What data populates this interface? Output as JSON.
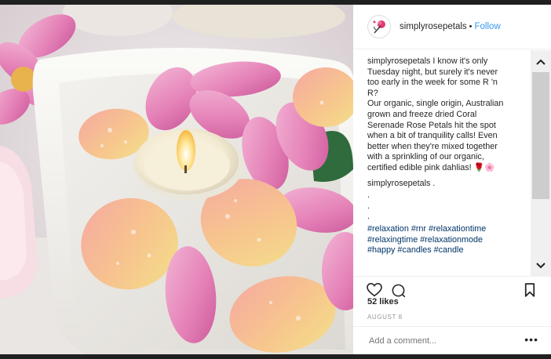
{
  "header": {
    "username": "simplyrosepetals",
    "separator": "•",
    "follow_label": "Follow"
  },
  "caption": {
    "author": "simplyrosepetals",
    "paragraph1": "I know it's only Tuesday night, but surely it's never too early in the week for some R 'n R?",
    "paragraph2": "Our organic, single origin, Australian grown and freeze dried Coral Serenade Rose Petals hit the spot when a bit of tranquility calls! Even better when they're mixed together with a sprinkling of our organic, certified edible pink dahlias! 🌹🌸",
    "author2": "simplyrosepetals",
    "trail": " .",
    "dots": [
      ".",
      ".",
      "."
    ],
    "hashtags": "#relaxation #rnr #relaxationtime #relaxingtime #relaxationmode #happy #candles #candle"
  },
  "likes": "52 likes",
  "date": "AUGUST 8",
  "comment": {
    "placeholder": "Add a comment...",
    "more_label": "•••"
  },
  "icons": {
    "avatar": "rose-logo-icon",
    "like": "heart-icon",
    "comment": "comment-bubble-icon",
    "save": "bookmark-icon",
    "scroll_up": "chevron-up-icon",
    "scroll_down": "chevron-down-icon"
  },
  "colors": {
    "follow": "#3897f0",
    "hashtag": "#003569",
    "text": "#262626",
    "muted": "#999999"
  }
}
